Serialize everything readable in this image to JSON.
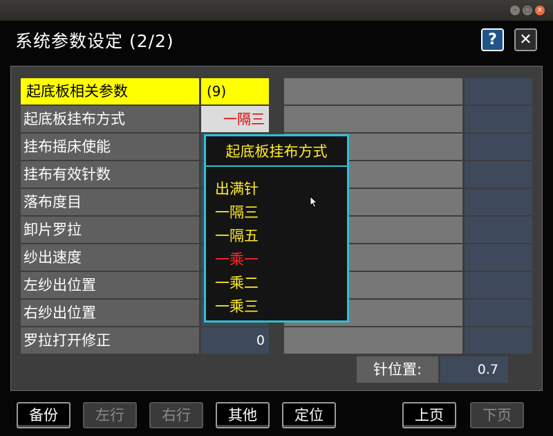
{
  "window": {
    "title": "系统参数设定 (2/2)"
  },
  "header": {
    "help_label": "?",
    "close_label": "✕"
  },
  "params": {
    "header_label": "起底板相关参数",
    "header_value": "(9)",
    "rows": [
      {
        "label": "起底板挂布方式",
        "value": "一隔三"
      },
      {
        "label": "挂布摇床使能",
        "value": ""
      },
      {
        "label": "挂布有效针数",
        "value": ""
      },
      {
        "label": "落布度目",
        "value": ""
      },
      {
        "label": "卸片罗拉",
        "value": ""
      },
      {
        "label": "纱出速度",
        "value": ""
      },
      {
        "label": "左纱出位置",
        "value": ""
      },
      {
        "label": "右纱出位置",
        "value": ""
      },
      {
        "label": "罗拉打开修正",
        "value": "0"
      }
    ]
  },
  "needle": {
    "label": "针位置:",
    "value": "0.7"
  },
  "popup": {
    "title": "起底板挂布方式",
    "options": [
      "出满针",
      "一隔三",
      "一隔五",
      "一乘一",
      "一乘二",
      "一乘三"
    ],
    "selected_index": 3
  },
  "footer": {
    "backup": "备份",
    "left": "左行",
    "right": "右行",
    "other": "其他",
    "locate": "定位",
    "prev": "上页",
    "next": "下页"
  },
  "colors": {
    "highlight": "#ffff00",
    "popup_border": "#2ec0d6",
    "selected": "#ff2a2a"
  }
}
